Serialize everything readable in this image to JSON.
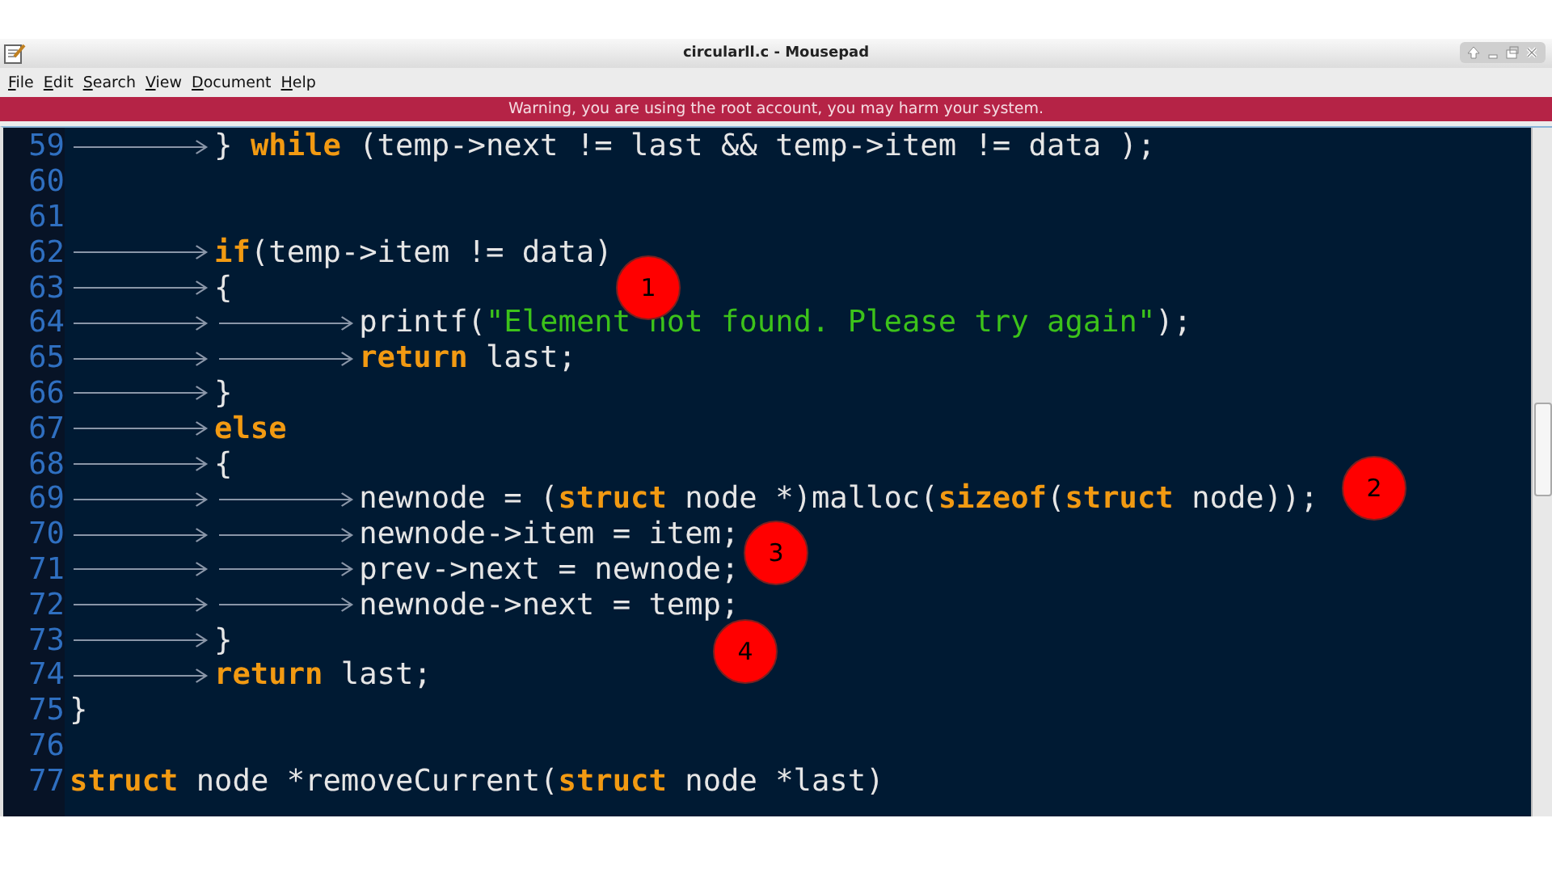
{
  "window": {
    "title": "circularll.c - Mousepad"
  },
  "menu": [
    {
      "label": "File"
    },
    {
      "label": "Edit"
    },
    {
      "label": "Search"
    },
    {
      "label": "View"
    },
    {
      "label": "Document"
    },
    {
      "label": "Help"
    }
  ],
  "warning": "Warning, you are using the root account, you may harm your system.",
  "lines": [
    {
      "number": "59",
      "tokens": [
        {
          "kind": "tab"
        },
        {
          "kind": "code",
          "text": "} "
        },
        {
          "kind": "keyword",
          "text": "while"
        },
        {
          "kind": "code",
          "text": " (temp->next != last && temp->item != data );"
        }
      ]
    },
    {
      "number": "60"
    },
    {
      "number": "61"
    },
    {
      "number": "62",
      "tokens": [
        {
          "kind": "tab"
        },
        {
          "kind": "keyword",
          "text": "if"
        },
        {
          "kind": "code",
          "text": "(temp->item != data)"
        }
      ]
    },
    {
      "number": "63",
      "tokens": [
        {
          "kind": "tab"
        },
        {
          "kind": "code",
          "text": "{"
        }
      ]
    },
    {
      "number": "64",
      "tokens": [
        {
          "kind": "tab"
        },
        {
          "kind": "tab"
        },
        {
          "kind": "code",
          "text": "printf("
        },
        {
          "kind": "string",
          "text": "\"Element not found. Please try again\""
        },
        {
          "kind": "code",
          "text": ");"
        }
      ]
    },
    {
      "number": "65",
      "tokens": [
        {
          "kind": "tab"
        },
        {
          "kind": "tab"
        },
        {
          "kind": "keyword",
          "text": "return"
        },
        {
          "kind": "code",
          "text": " last;"
        }
      ]
    },
    {
      "number": "66",
      "tokens": [
        {
          "kind": "tab"
        },
        {
          "kind": "code",
          "text": "}"
        }
      ]
    },
    {
      "number": "67",
      "tokens": [
        {
          "kind": "tab"
        },
        {
          "kind": "keyword",
          "text": "else"
        }
      ]
    },
    {
      "number": "68",
      "tokens": [
        {
          "kind": "tab"
        },
        {
          "kind": "code",
          "text": "{"
        }
      ]
    },
    {
      "number": "69",
      "tokens": [
        {
          "kind": "tab"
        },
        {
          "kind": "tab"
        },
        {
          "kind": "code",
          "text": "newnode = ("
        },
        {
          "kind": "keyword",
          "text": "struct"
        },
        {
          "kind": "code",
          "text": " node *)malloc("
        },
        {
          "kind": "keyword",
          "text": "sizeof"
        },
        {
          "kind": "code",
          "text": "("
        },
        {
          "kind": "keyword",
          "text": "struct"
        },
        {
          "kind": "code",
          "text": " node));"
        }
      ]
    },
    {
      "number": "70",
      "tokens": [
        {
          "kind": "tab"
        },
        {
          "kind": "tab"
        },
        {
          "kind": "code",
          "text": "newnode->item = item;"
        }
      ]
    },
    {
      "number": "71",
      "tokens": [
        {
          "kind": "tab"
        },
        {
          "kind": "tab"
        },
        {
          "kind": "code",
          "text": "prev->next = newnode;"
        }
      ]
    },
    {
      "number": "72",
      "tokens": [
        {
          "kind": "tab"
        },
        {
          "kind": "tab"
        },
        {
          "kind": "code",
          "text": "newnode->next = temp;"
        }
      ]
    },
    {
      "number": "73",
      "tokens": [
        {
          "kind": "tab"
        },
        {
          "kind": "code",
          "text": "}"
        }
      ]
    },
    {
      "number": "74",
      "tokens": [
        {
          "kind": "tab"
        },
        {
          "kind": "keyword",
          "text": "return"
        },
        {
          "kind": "code",
          "text": " last;"
        }
      ]
    },
    {
      "number": "75",
      "tokens": [
        {
          "kind": "code",
          "text": "}"
        }
      ]
    },
    {
      "number": "76"
    },
    {
      "number": "77",
      "tokens": [
        {
          "kind": "keyword",
          "text": "struct"
        },
        {
          "kind": "code",
          "text": " node *removeCurrent("
        },
        {
          "kind": "keyword",
          "text": "struct"
        },
        {
          "kind": "code",
          "text": " node *last)"
        }
      ]
    }
  ],
  "markers": [
    {
      "label": "1"
    },
    {
      "label": "2"
    },
    {
      "label": "3"
    },
    {
      "label": "4"
    }
  ]
}
